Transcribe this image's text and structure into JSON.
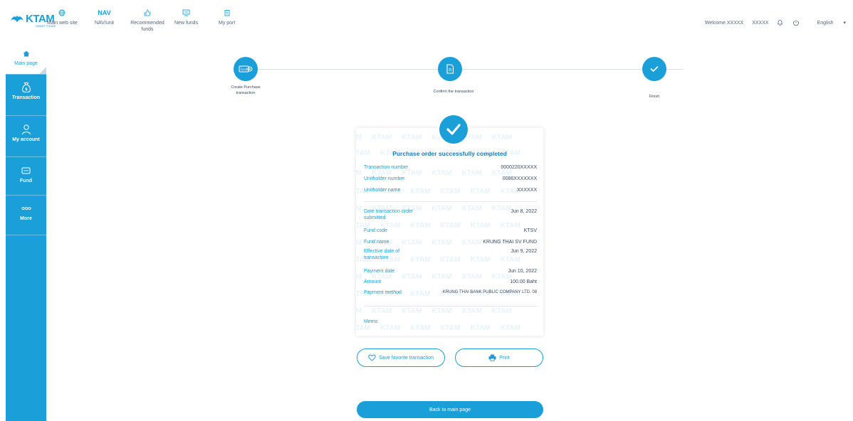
{
  "brand": {
    "logo_text": "KTAM",
    "logo_sub": "SMART TRADE"
  },
  "topnav": [
    {
      "id": "web",
      "label": "Main web site",
      "icon": "globe-icon"
    },
    {
      "id": "nav",
      "label": "NAV/unit",
      "strong": "NAV"
    },
    {
      "id": "recommended",
      "label": "Recommended funds",
      "icon": "thumbs-up-icon"
    },
    {
      "id": "new",
      "label": "New funds",
      "icon": "monitor-icon"
    },
    {
      "id": "port",
      "label": "My port",
      "icon": "clipboard-icon"
    }
  ],
  "user": {
    "welcome": "Welcome XXXXX",
    "name": "XXXXX",
    "language": "English"
  },
  "sidebar": [
    {
      "id": "main",
      "label": "Main page",
      "icon": "home-icon",
      "active": true
    },
    {
      "id": "transaction",
      "label": "Transaction",
      "icon": "money-bag-icon"
    },
    {
      "id": "account",
      "label": "My account",
      "icon": "user-icon"
    },
    {
      "id": "fund",
      "label": "Fund",
      "icon": "fund-card-icon"
    },
    {
      "id": "more",
      "label": "More",
      "icon": "dots-icon"
    }
  ],
  "stepper": [
    {
      "label": "Create Purchase transaction",
      "icon": "fund-tag-icon"
    },
    {
      "label": "Confirm the transaction",
      "icon": "document-icon"
    },
    {
      "label": "Finish",
      "icon": "check-icon"
    }
  ],
  "receipt": {
    "title": "Purchase order successfully completed",
    "watermark": "KTAM",
    "rows": [
      {
        "label": "Transaction number",
        "value": "0000220XXXXX"
      },
      {
        "label": "Unitholder number",
        "value": "0086XXXXXXX"
      },
      {
        "label": "Unitholder name",
        "value": "XXXXXX"
      },
      {
        "label": "Date transaction order submitted",
        "value": "Jun 8, 2022"
      },
      {
        "label": "Fund code",
        "value": "KTSV"
      },
      {
        "label": "Fund name",
        "value": "KRUNG THAI SV FUND"
      },
      {
        "label": "Effective date of transaction",
        "value": "Jun 9, 2022"
      },
      {
        "label": "Payment date",
        "value": "Jun 10, 2022"
      },
      {
        "label": "Amount",
        "value": "100.00  Baht"
      },
      {
        "label": "Payment method",
        "value": "KRUNG THAI BANK PUBLIC COMPANY LTD. 08"
      },
      {
        "label": "Memo",
        "value": ""
      }
    ]
  },
  "actions": {
    "save_favorite": "Save favorite transaction",
    "print": "Print",
    "back": "Back to main page"
  },
  "colors": {
    "primary": "#1a9fd9",
    "text": "#3b4a5e"
  }
}
